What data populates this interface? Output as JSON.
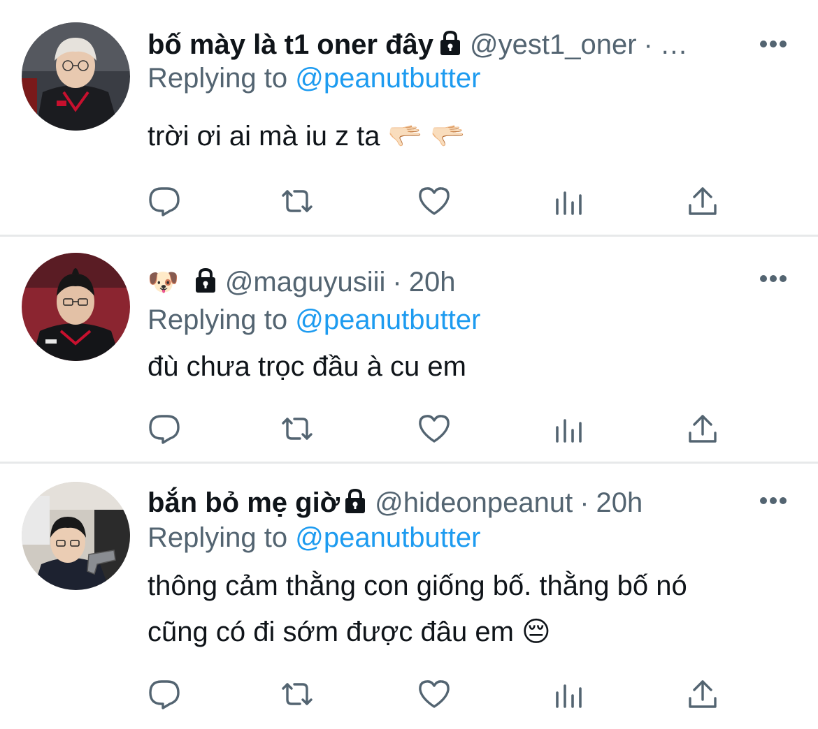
{
  "colors": {
    "text_primary": "#0f1419",
    "text_secondary": "#536471",
    "link": "#1d9bf0",
    "divider": "#e7e9ea"
  },
  "tweets": [
    {
      "display_name": "bố mày là t1 oner đây",
      "handle": "@yest1_oner",
      "separator": "·",
      "time": "…",
      "reply_prefix": "Replying to",
      "reply_handle": "@peanutbutter",
      "body": "trời ơi ai mà iu z ta 🫳🏻 🫳🏻"
    },
    {
      "display_name": "🐶",
      "handle": "@maguyusiii",
      "separator": "·",
      "time": "20h",
      "reply_prefix": "Replying to",
      "reply_handle": "@peanutbutter",
      "body": "đù chưa trọc đầu à cu em"
    },
    {
      "display_name": "bắn bỏ mẹ giờ",
      "handle": "@hideonpeanut",
      "separator": "·",
      "time": "20h",
      "reply_prefix": "Replying to",
      "reply_handle": "@peanutbutter",
      "body_lines": [
        "thông cảm thằng con giống bố. thằng bố nó",
        "cũng có đi sớm được đâu em 😔"
      ]
    }
  ],
  "icons": {
    "reply": "reply-icon",
    "retweet": "retweet-icon",
    "like": "like-icon",
    "views": "views-icon",
    "share": "share-icon",
    "more": "more-icon",
    "lock": "lock-icon"
  }
}
